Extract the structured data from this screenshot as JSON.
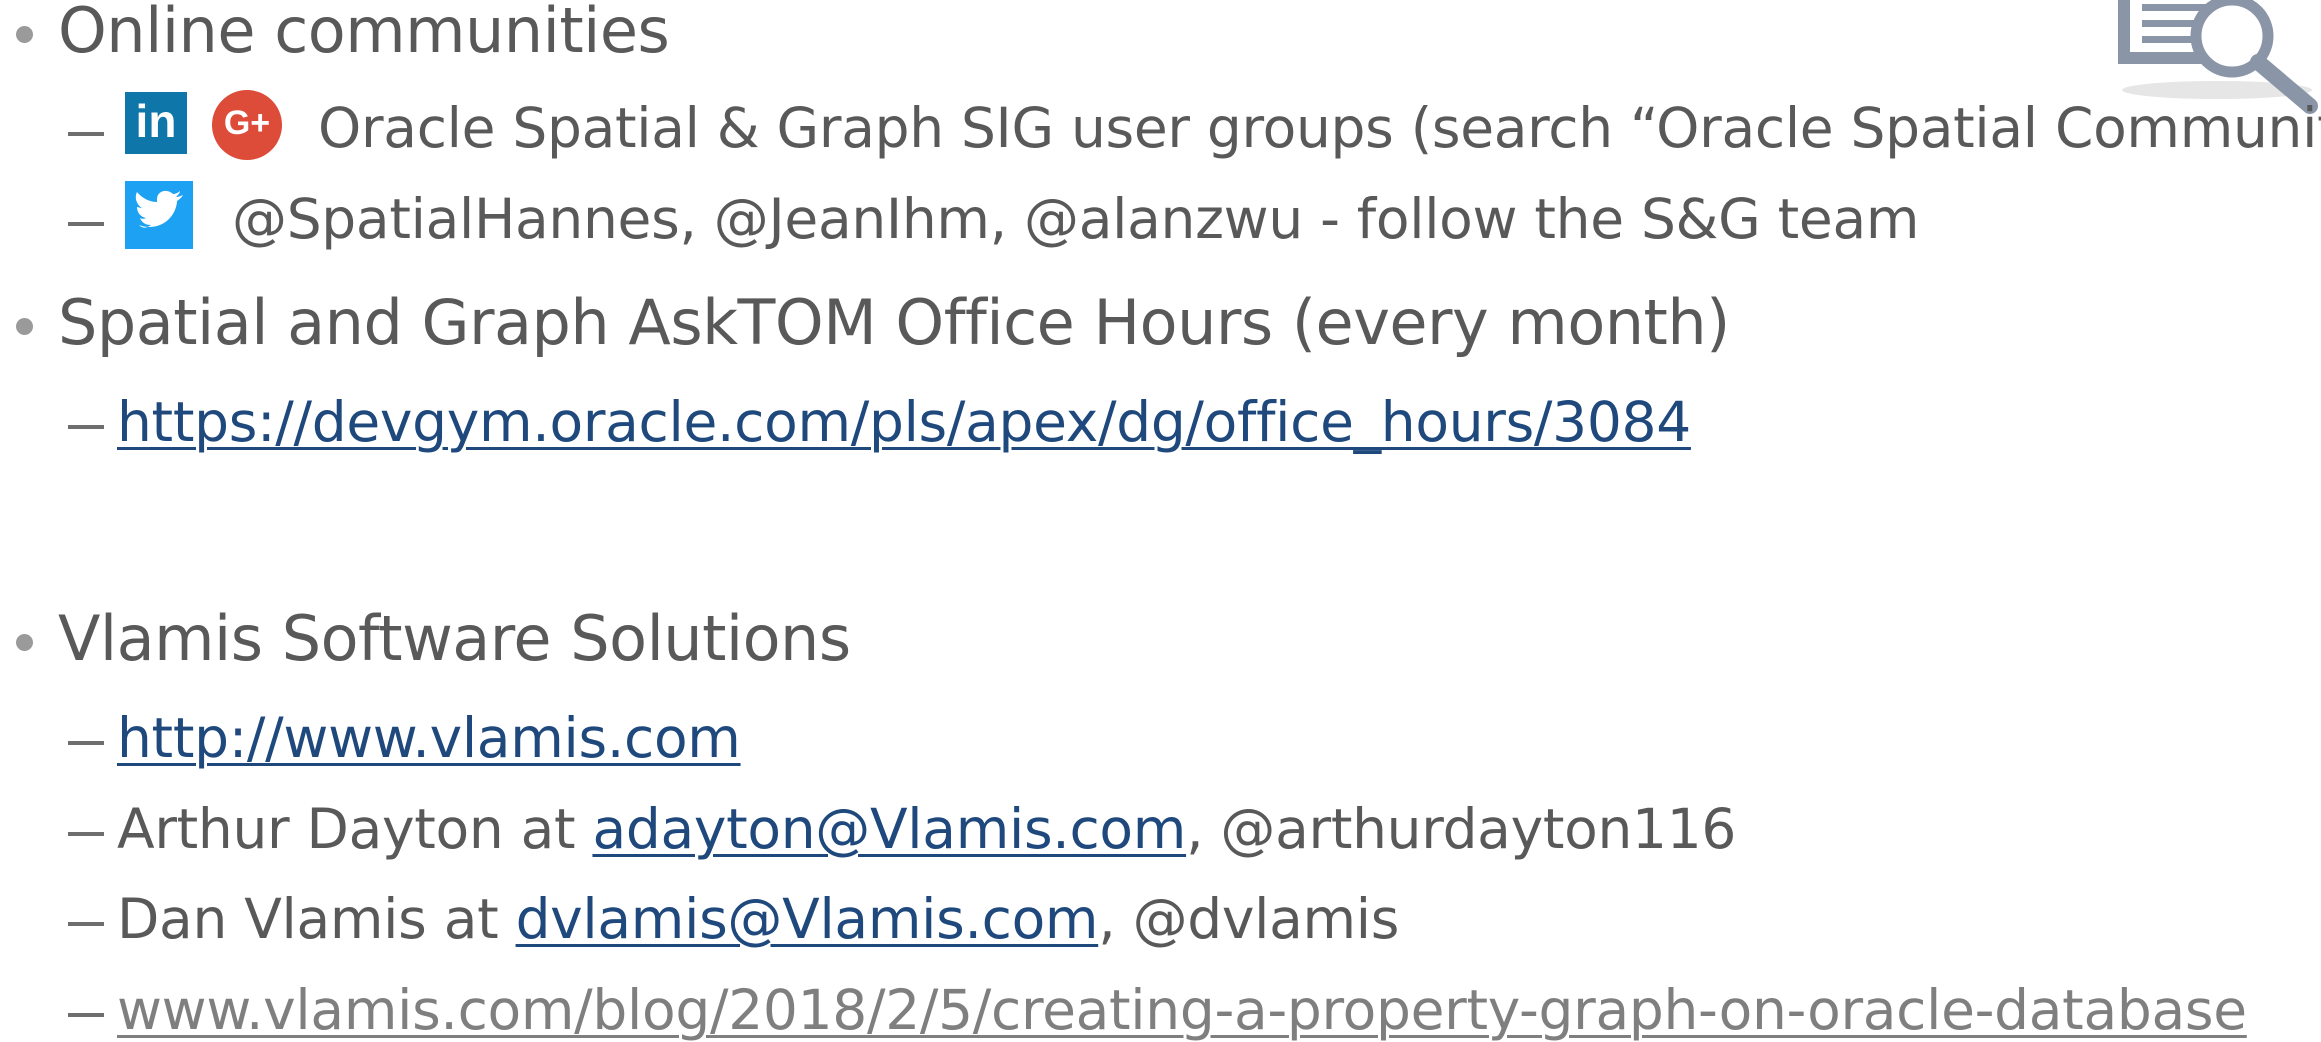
{
  "colors": {
    "text": "#595959",
    "link": "#1f497d",
    "faded_link": "#7f7f7f",
    "linkedin": "#0e76a8",
    "google_plus": "#dd4b39",
    "twitter": "#1da1f2"
  },
  "sections": {
    "online": {
      "heading": "Online communities",
      "sig_text": "Oracle Spatial & Graph SIG user groups (search “Oracle Spatial Community”)",
      "twitter_text": "@SpatialHannes, @JeanIhm, @alanzwu  - follow the S&G team",
      "linkedin_glyph": "in",
      "google_glyph": "G+"
    },
    "asktom": {
      "heading": "Spatial and Graph AskTOM Office Hours (every month)",
      "url": "https://devgym.oracle.com/pls/apex/dg/office_hours/3084"
    },
    "vlamis": {
      "heading": "Vlamis Software Solutions",
      "site_url": "http://www.vlamis.com",
      "arthur_prefix": "Arthur Dayton at ",
      "arthur_email": "adayton@Vlamis.com",
      "arthur_suffix": ", @arthurdayton116",
      "dan_prefix": "Dan Vlamis at ",
      "dan_email": "dvlamis@Vlamis.com",
      "dan_suffix": ", @dvlamis",
      "blog_url": "www.vlamis.com/blog/2018/2/5/creating-a-property-graph-on-oracle-database"
    }
  },
  "icons": {
    "corner": "search-document-icon",
    "linkedin": "linkedin-icon",
    "google": "google-plus-icon",
    "twitter": "twitter-icon"
  }
}
